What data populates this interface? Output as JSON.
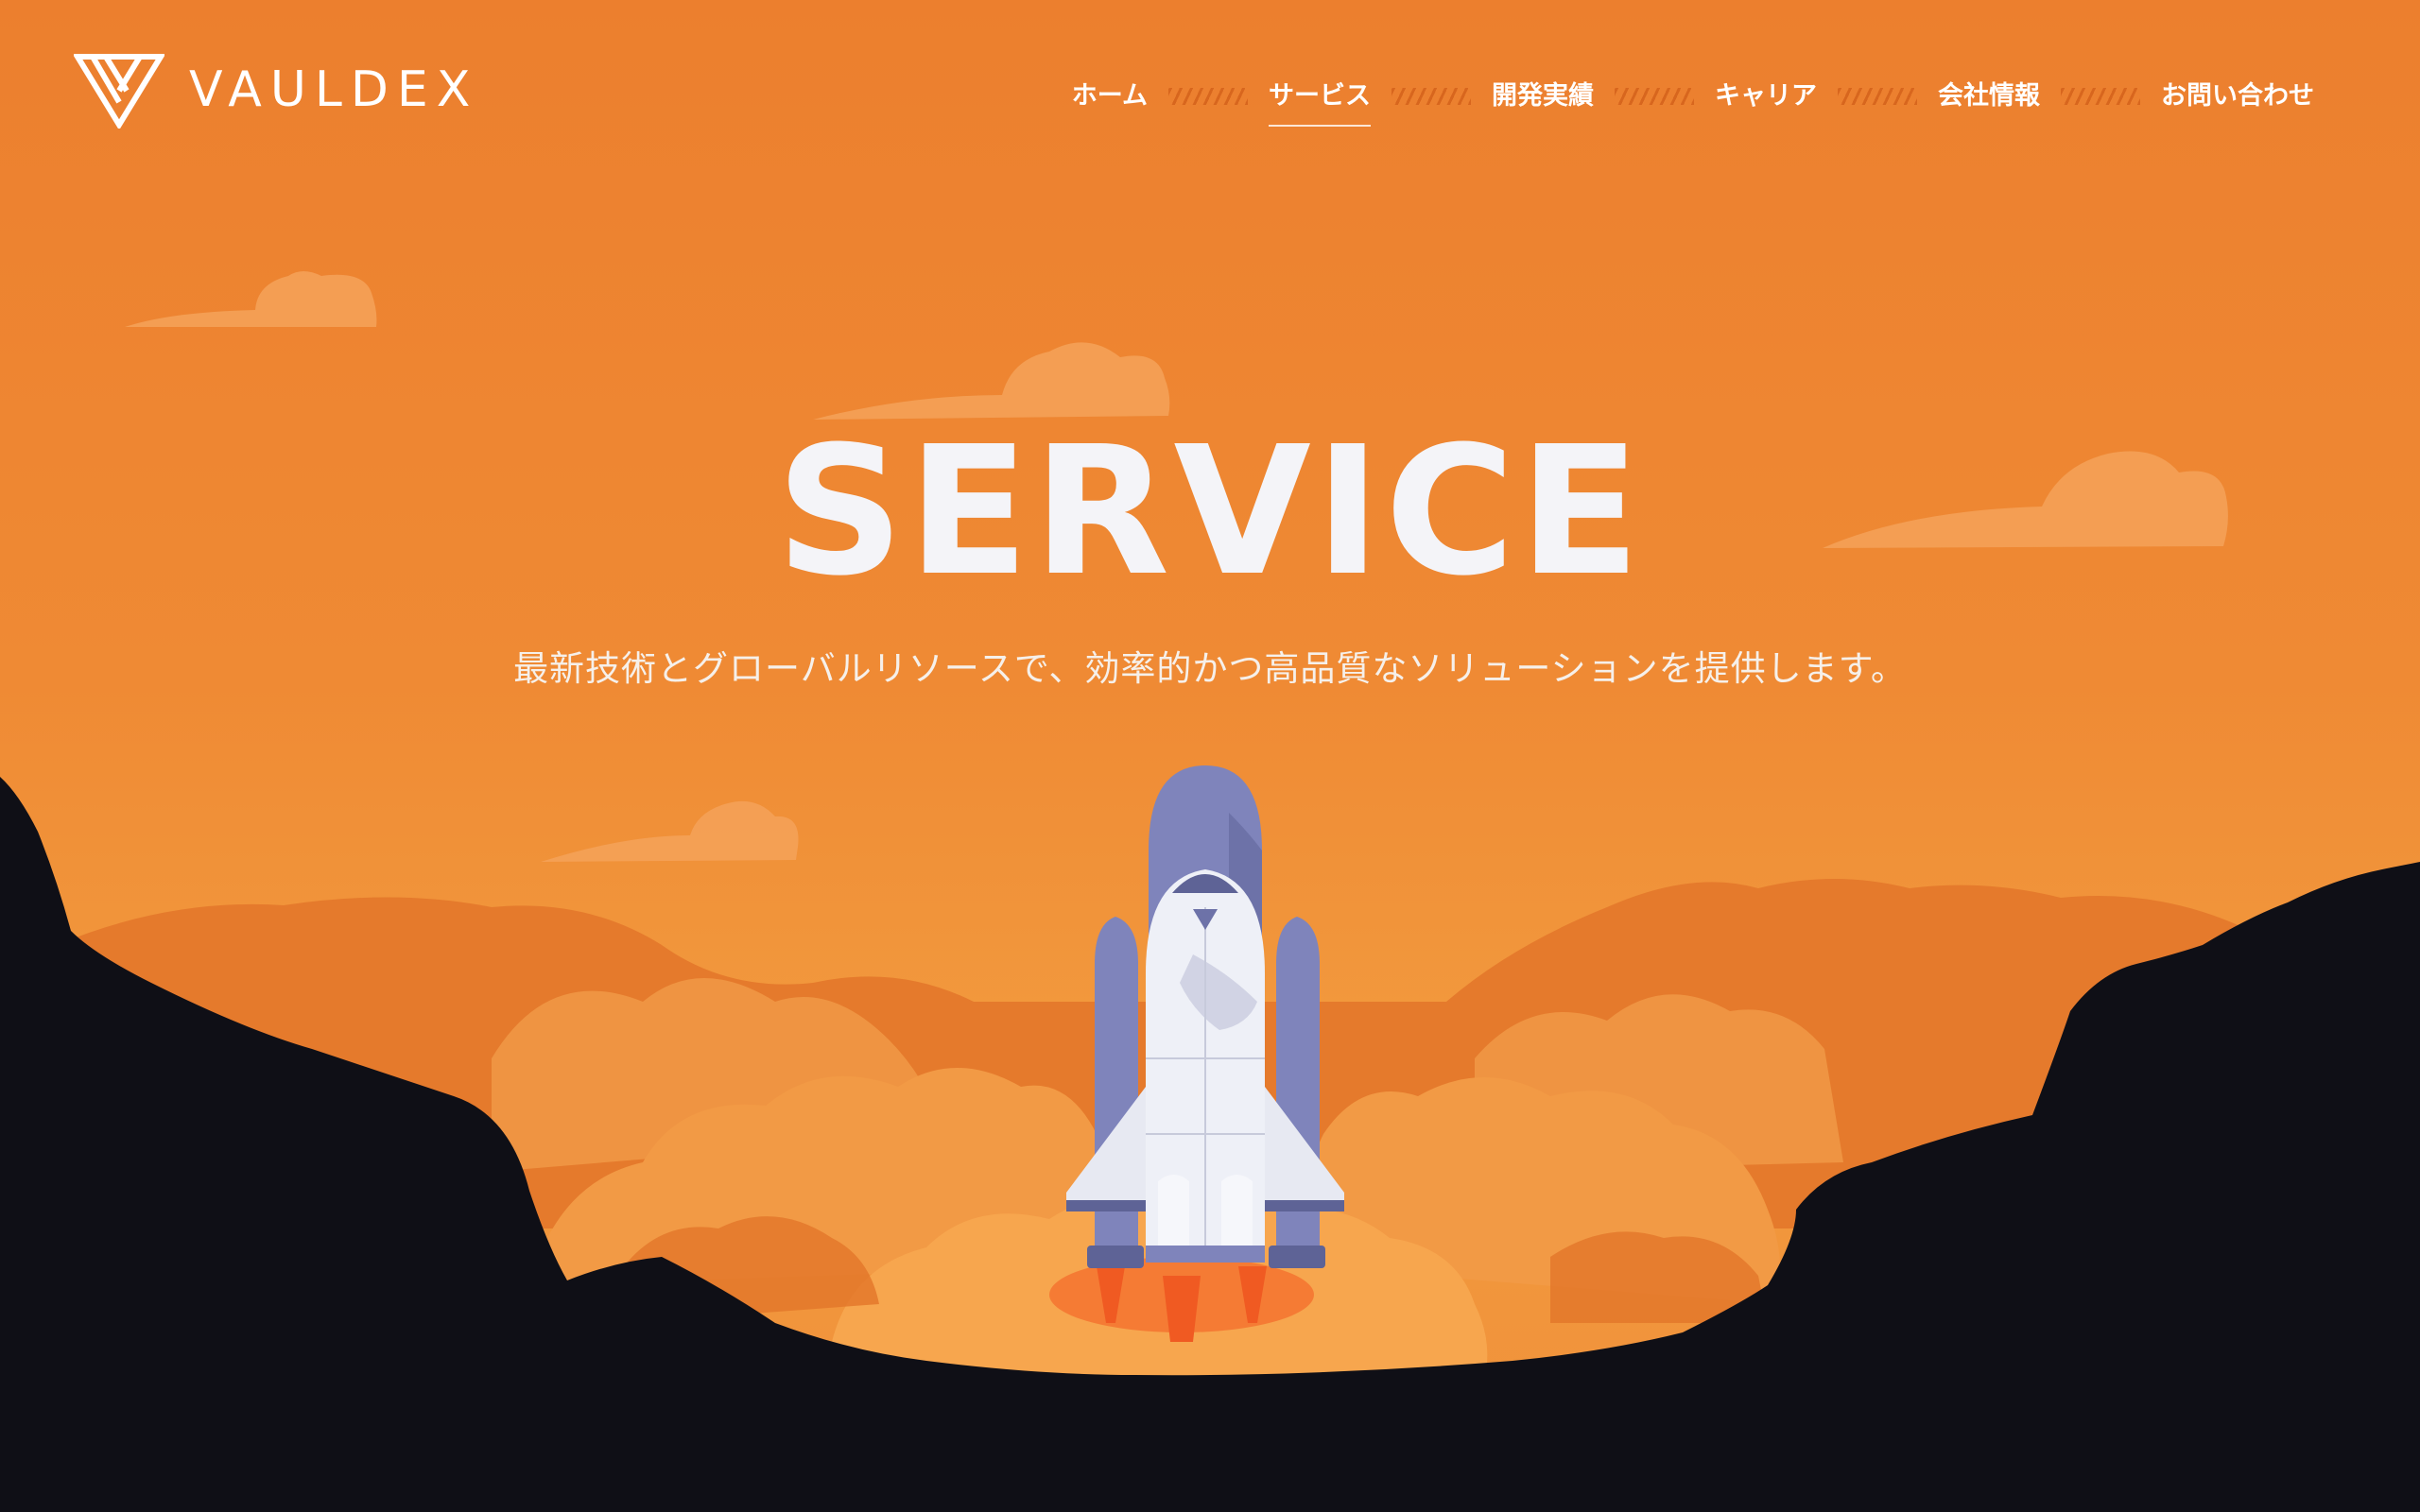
{
  "brand": {
    "name": "VAULDEX",
    "logo_icon": "vauldex-triangle-logo-icon"
  },
  "nav": {
    "items": [
      {
        "label": "ホーム",
        "active": false
      },
      {
        "label": "サービス",
        "active": true
      },
      {
        "label": "開発実績",
        "active": false
      },
      {
        "label": "キャリア",
        "active": false
      },
      {
        "label": "会社情報",
        "active": false
      },
      {
        "label": "お問い合わせ",
        "active": false
      }
    ]
  },
  "hero": {
    "title": "SERVICE",
    "subtitle": "最新技術とグローバルリソースで、効率的かつ高品質なソリューションを提供します。"
  },
  "colors": {
    "sky": "#ee8532",
    "cloud": "#f5a259",
    "smoke_light": "#f7a64e",
    "smoke_dark": "#e2762a",
    "mountain": "#0f0f16",
    "rocket_body": "#eef0f7",
    "rocket_tank": "#7f84bb",
    "text_white": "#ffffff"
  }
}
